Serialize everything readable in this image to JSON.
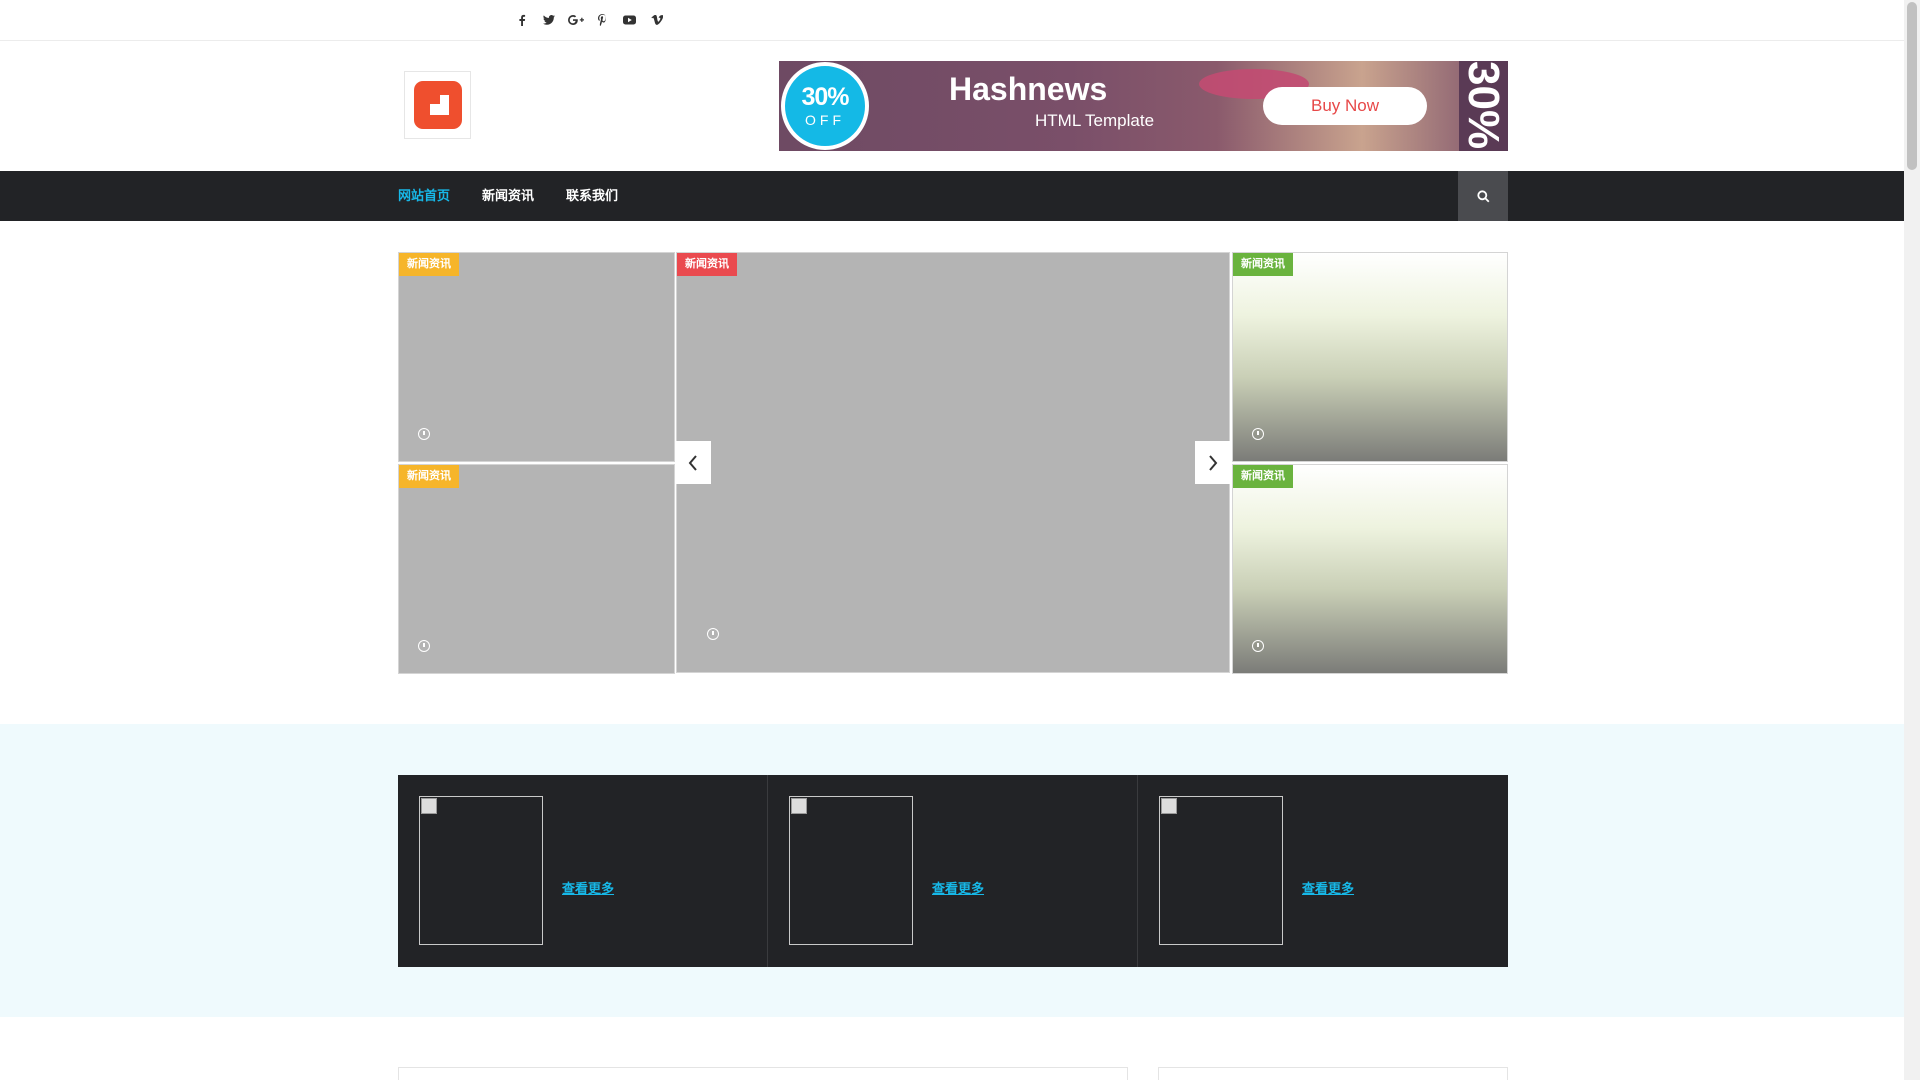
{
  "topbar": {
    "social_icons": [
      "facebook-icon",
      "twitter-icon",
      "google-plus-icon",
      "pinterest-icon",
      "youtube-icon",
      "vimeo-icon"
    ]
  },
  "banner": {
    "discount": "30%",
    "discount_word": "OFF",
    "title": "Hashnews",
    "subtitle": "HTML Template",
    "cta": "Buy Now",
    "side_text": "30%"
  },
  "nav": {
    "items": [
      {
        "label": "网站首页",
        "active": true
      },
      {
        "label": "新闻资讯",
        "active": false
      },
      {
        "label": "联系我们",
        "active": false
      }
    ],
    "search_icon": "search-icon"
  },
  "slider": {
    "tiles": [
      {
        "badge": "新闻资讯",
        "badge_color": "#f6b52a"
      },
      {
        "badge": "新闻资讯",
        "badge_color": "#f6b52a"
      },
      {
        "badge": "新闻资讯",
        "badge_color": "#ea4a4f"
      },
      {
        "badge": "新闻资讯",
        "badge_color": "#6ab33e"
      },
      {
        "badge": "新闻资讯",
        "badge_color": "#6ab33e"
      }
    ],
    "prev_icon": "chevron-left-icon",
    "next_icon": "chevron-right-icon"
  },
  "featured": {
    "cards": [
      {
        "link": "查看更多"
      },
      {
        "link": "查看更多"
      },
      {
        "link": "查看更多"
      }
    ]
  },
  "colors": {
    "accent": "#17b8e8",
    "nav_bg": "#222326",
    "logo": "#ef4f2e"
  }
}
